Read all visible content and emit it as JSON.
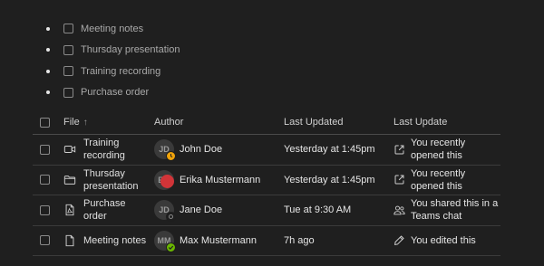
{
  "tasks": [
    {
      "label": "Meeting notes"
    },
    {
      "label": "Thursday presentation"
    },
    {
      "label": "Training recording"
    },
    {
      "label": "Purchase order"
    }
  ],
  "table": {
    "headers": {
      "file": "File",
      "sort_indicator": "↑",
      "author": "Author",
      "last_updated": "Last Updated",
      "last_update": "Last Update"
    },
    "rows": [
      {
        "file_icon": "video-icon",
        "file_line1": "Training",
        "file_line2": "recording",
        "author_initials": "JD",
        "author_name": "John Doe",
        "presence": "away",
        "last_updated": "Yesterday at 1:45pm",
        "action_icon": "open-external-icon",
        "action_line1": "You recently",
        "action_line2": "opened this"
      },
      {
        "file_icon": "folder-icon",
        "file_line1": "Thursday",
        "file_line2": "presentation",
        "author_initials": "EM",
        "author_name": "Erika Mustermann",
        "presence": "busy",
        "last_updated": "Yesterday at 1:45pm",
        "action_icon": "open-external-icon",
        "action_line1": "You recently",
        "action_line2": "opened this"
      },
      {
        "file_icon": "pdf-document-icon",
        "file_line1": "Purchase",
        "file_line2": "order",
        "author_initials": "JD",
        "author_name": "Jane Doe",
        "presence": "offline",
        "last_updated": "Tue at 9:30 AM",
        "action_icon": "people-icon",
        "action_line1": "You shared this in a",
        "action_line2": "Teams chat"
      },
      {
        "file_icon": "document-icon",
        "file_line1": "Meeting notes",
        "file_line2": "",
        "author_initials": "MM",
        "author_name": "Max Mustermann",
        "presence": "available",
        "last_updated": "7h ago",
        "action_icon": "pencil-icon",
        "action_line1": "You edited this",
        "action_line2": ""
      }
    ]
  }
}
